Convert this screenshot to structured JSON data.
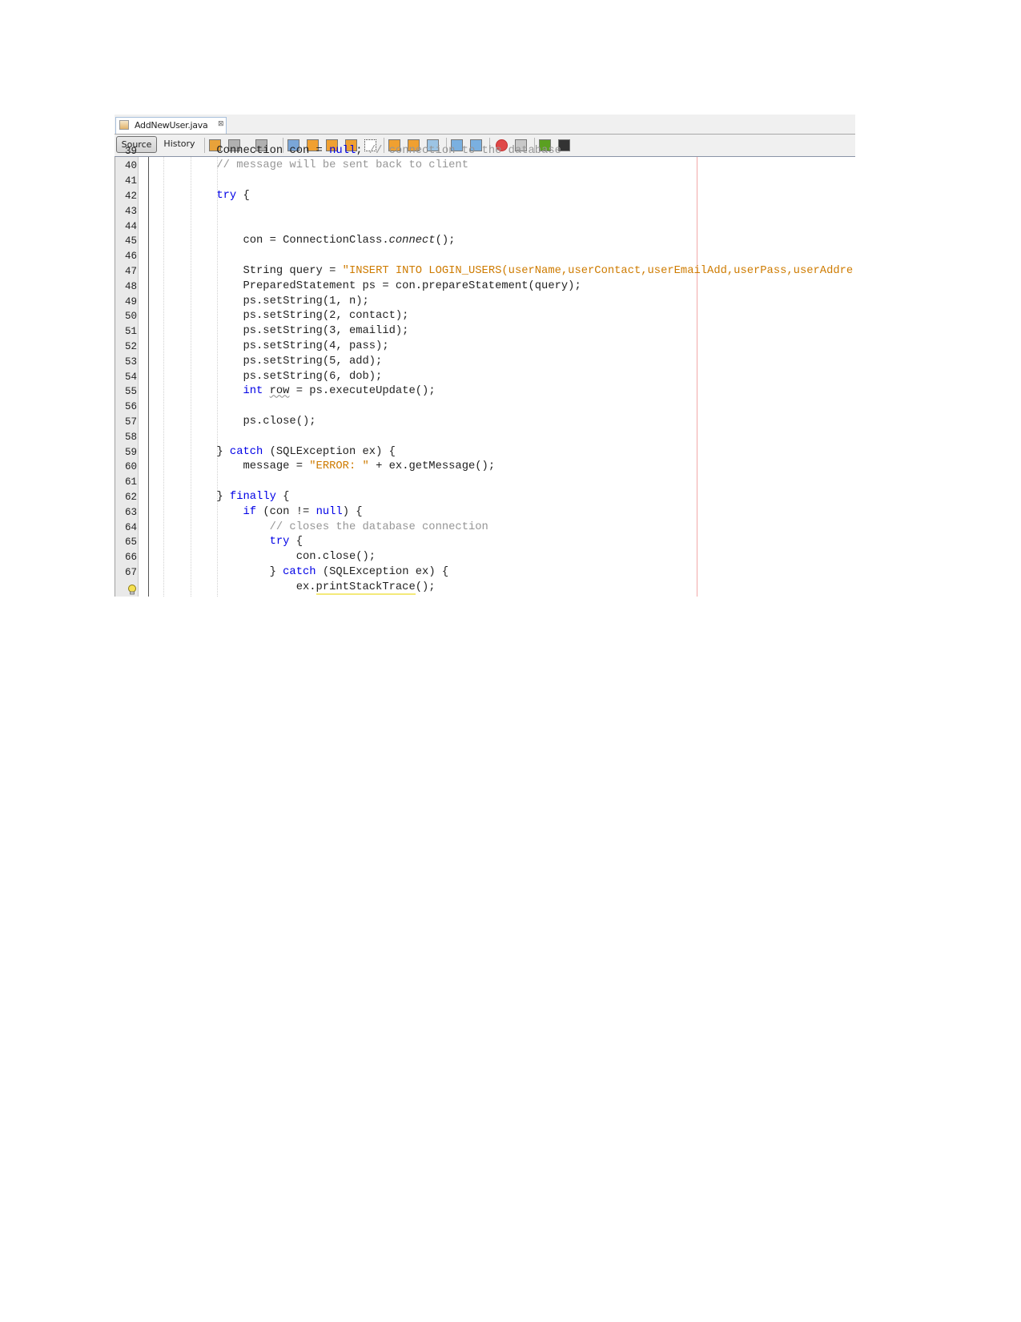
{
  "tab": {
    "filename": "AddNewUser.java",
    "close_glyph": "⊠",
    "icon": "java-file-icon"
  },
  "toolbar": {
    "source_label": "Source",
    "history_label": "History",
    "icons": [
      "last-edit-icon",
      "back-icon",
      "forward-icon",
      "find-selection-icon",
      "find-previous-icon",
      "find-next-icon",
      "toggle-highlight-icon",
      "toggle-rect-selection-icon",
      "previous-bookmark-icon",
      "next-bookmark-icon",
      "toggle-bookmark-icon",
      "shift-left-icon",
      "shift-right-icon",
      "start-macro-icon",
      "stop-macro-icon",
      "comment-icon",
      "uncomment-icon"
    ]
  },
  "colors": {
    "keyword": "#0000e6",
    "string": "#ce7b00",
    "comment": "#969696",
    "margin_line": "#f2a8a8"
  },
  "lines": [
    {
      "no": "39",
      "segs": [
        [
          "            Connection con = ",
          ""
        ],
        [
          "null",
          "kw"
        ],
        [
          "; ",
          ""
        ],
        [
          "// connection to the database",
          "cm"
        ]
      ]
    },
    {
      "no": "40",
      "segs": [
        [
          "            ",
          ""
        ],
        [
          "// message will be sent back to client",
          "cm"
        ]
      ]
    },
    {
      "no": "41",
      "segs": []
    },
    {
      "no": "42",
      "segs": [
        [
          "            ",
          ""
        ],
        [
          "try",
          "kw"
        ],
        [
          " {",
          ""
        ]
      ]
    },
    {
      "no": "43",
      "segs": []
    },
    {
      "no": "44",
      "segs": []
    },
    {
      "no": "45",
      "segs": [
        [
          "                con = ConnectionClass.",
          ""
        ],
        [
          "connect",
          "it"
        ],
        [
          "();",
          ""
        ]
      ]
    },
    {
      "no": "46",
      "segs": []
    },
    {
      "no": "47",
      "segs": [
        [
          "                String query = ",
          ""
        ],
        [
          "\"INSERT INTO LOGIN_USERS(userName,userContact,userEmailAdd,userPass,userAddre",
          "str"
        ]
      ]
    },
    {
      "no": "48",
      "segs": [
        [
          "                PreparedStatement ps = con.prepareStatement(query);",
          ""
        ]
      ]
    },
    {
      "no": "49",
      "segs": [
        [
          "                ps.setString(1, n);",
          ""
        ]
      ]
    },
    {
      "no": "50",
      "segs": [
        [
          "                ps.setString(2, contact);",
          ""
        ]
      ]
    },
    {
      "no": "51",
      "segs": [
        [
          "                ps.setString(3, emailid);",
          ""
        ]
      ]
    },
    {
      "no": "52",
      "segs": [
        [
          "                ps.setString(4, pass);",
          ""
        ]
      ]
    },
    {
      "no": "53",
      "segs": [
        [
          "                ps.setString(5, add);",
          ""
        ]
      ]
    },
    {
      "no": "54",
      "segs": [
        [
          "                ps.setString(6, dob);",
          ""
        ]
      ]
    },
    {
      "no": "55",
      "segs": [
        [
          "                ",
          ""
        ],
        [
          "int",
          "kw"
        ],
        [
          " ",
          ""
        ],
        [
          "row",
          "warn"
        ],
        [
          " = ps.executeUpdate();",
          ""
        ]
      ]
    },
    {
      "no": "56",
      "segs": []
    },
    {
      "no": "57",
      "segs": [
        [
          "                ps.close();",
          ""
        ]
      ]
    },
    {
      "no": "58",
      "segs": []
    },
    {
      "no": "59",
      "segs": [
        [
          "            } ",
          ""
        ],
        [
          "catch",
          "kw"
        ],
        [
          " (SQLException ex) {",
          ""
        ]
      ]
    },
    {
      "no": "60",
      "segs": [
        [
          "                message = ",
          ""
        ],
        [
          "\"ERROR: \"",
          "str"
        ],
        [
          " + ex.getMessage();",
          ""
        ]
      ]
    },
    {
      "no": "61",
      "segs": []
    },
    {
      "no": "62",
      "segs": [
        [
          "            } ",
          ""
        ],
        [
          "finally",
          "kw"
        ],
        [
          " {",
          ""
        ]
      ]
    },
    {
      "no": "63",
      "segs": [
        [
          "                ",
          ""
        ],
        [
          "if",
          "kw"
        ],
        [
          " (con != ",
          ""
        ],
        [
          "null",
          "kw"
        ],
        [
          ") {",
          ""
        ]
      ]
    },
    {
      "no": "64",
      "segs": [
        [
          "                    ",
          ""
        ],
        [
          "// closes the database connection",
          "cm"
        ]
      ]
    },
    {
      "no": "65",
      "segs": [
        [
          "                    ",
          ""
        ],
        [
          "try",
          "kw"
        ],
        [
          " {",
          ""
        ]
      ]
    },
    {
      "no": "66",
      "segs": [
        [
          "                        con.close();",
          ""
        ]
      ]
    },
    {
      "no": "67",
      "segs": [
        [
          "                    } ",
          ""
        ],
        [
          "catch",
          "kw"
        ],
        [
          " (SQLException ex) {",
          ""
        ]
      ]
    },
    {
      "no": "",
      "hint": "lightbulb-icon",
      "segs": [
        [
          "                        ex.",
          ""
        ],
        [
          "printStackTrace",
          "hl"
        ],
        [
          "();",
          ""
        ]
      ]
    }
  ]
}
